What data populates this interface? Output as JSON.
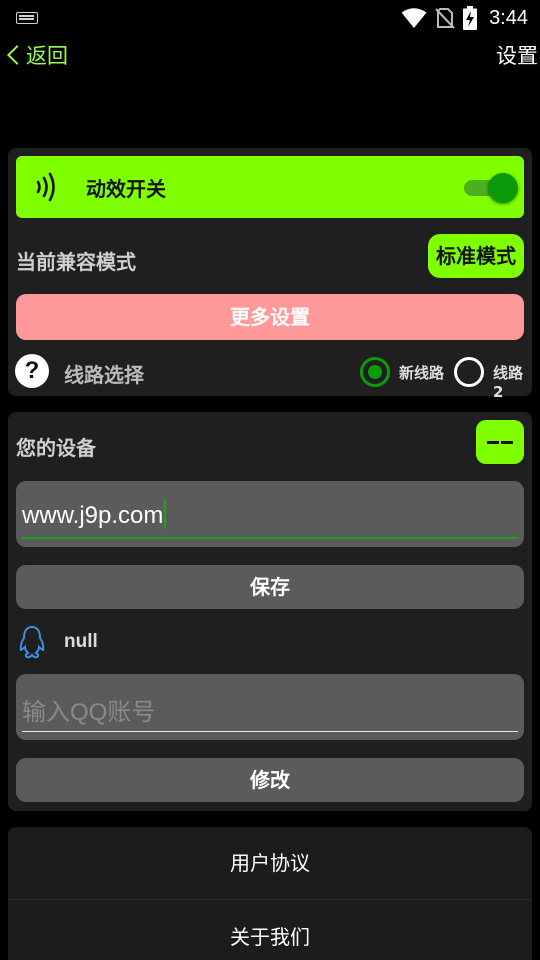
{
  "status_bar": {
    "time": "3:44",
    "icons": [
      "keyboard-icon",
      "wifi-icon",
      "no-sim-icon",
      "battery-charging-icon"
    ]
  },
  "header": {
    "back_label": "返回",
    "title": "设置"
  },
  "effects_card": {
    "effect_switch_label": "动效开关",
    "effect_switch_on": true,
    "compat_mode_label": "当前兼容模式",
    "compat_mode_value": "标准模式",
    "more_settings_label": "更多设置",
    "route_label": "线路选择",
    "route_options": [
      "新线路",
      "线路2"
    ],
    "route_selected": "新线路"
  },
  "device_card": {
    "title": "您的设备",
    "url_value": "www.j9p.com",
    "save_label": "保存",
    "qq_status": "null",
    "qq_placeholder": "输入QQ账号",
    "modify_label": "修改"
  },
  "menu": {
    "items": [
      "用户协议",
      "关于我们"
    ]
  },
  "colors": {
    "accent_green": "#80FF00",
    "back_text": "#9BFF4A",
    "more_button": "#FF9999",
    "radio_selected": "#0A9A0A",
    "background": "#000000",
    "card": "#1F1F1F"
  }
}
